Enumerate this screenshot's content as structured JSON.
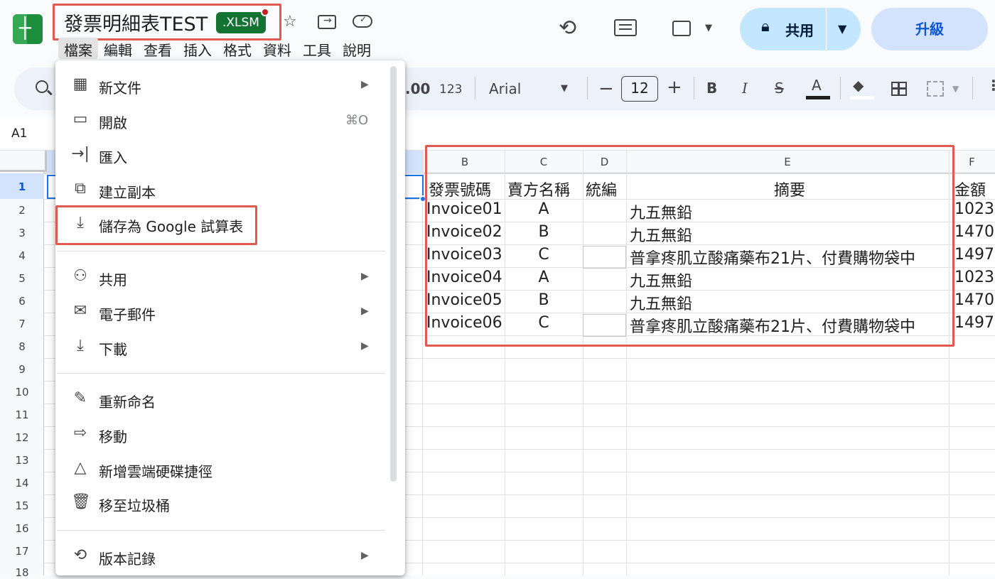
{
  "header": {
    "doc_title": "發票明細表TEST",
    "badge": ".XLSM",
    "menu": [
      "檔案",
      "編輯",
      "查看",
      "插入",
      "格式",
      "資料",
      "工具",
      "說明"
    ],
    "share_label": "共用",
    "upgrade_label": "升級"
  },
  "toolbar": {
    "decimal_label": ".00",
    "number_format_label": "123",
    "font_name": "Arial",
    "font_size": "12",
    "bold_label": "B",
    "italic_label": "I",
    "text_color_label": "A"
  },
  "namebox": "A1",
  "file_menu": {
    "items": [
      {
        "label": "新文件",
        "icon": "new-doc-icon"
      },
      {
        "label": "開啟",
        "icon": "folder-icon",
        "shortcut": "⌘O"
      },
      {
        "label": "匯入",
        "icon": "import-icon"
      },
      {
        "label": "建立副本",
        "icon": "copy-icon"
      },
      {
        "label": "儲存為 Google 試算表",
        "icon": "save-icon"
      },
      {
        "label": "共用",
        "icon": "person-add-icon"
      },
      {
        "label": "電子郵件",
        "icon": "mail-icon"
      },
      {
        "label": "下載",
        "icon": "download-icon"
      },
      {
        "label": "重新命名",
        "icon": "pencil-icon"
      },
      {
        "label": "移動",
        "icon": "move-icon"
      },
      {
        "label": "新增雲端硬碟捷徑",
        "icon": "drive-shortcut-icon"
      },
      {
        "label": "移至垃圾桶",
        "icon": "trash-icon"
      },
      {
        "label": "版本記錄",
        "icon": "history-icon"
      }
    ]
  },
  "grid": {
    "row_numbers": [
      "1",
      "2",
      "3",
      "4",
      "5",
      "6",
      "7",
      "8",
      "9",
      "10",
      "11",
      "12",
      "13",
      "14",
      "15",
      "16",
      "17",
      "18"
    ],
    "column_headers": [
      "B",
      "C",
      "D",
      "E",
      "F"
    ],
    "header_row": [
      "發票號碼",
      "賣方名稱",
      "統編",
      "摘要",
      "金額"
    ],
    "rows": [
      [
        "Invoice01",
        "A",
        "",
        "九五無鉛",
        "1023"
      ],
      [
        "Invoice02",
        "B",
        "",
        "九五無鉛",
        "1470"
      ],
      [
        "Invoice03",
        "C",
        "",
        "普拿疼肌立酸痛藥布21片、付費購物袋中",
        "1497"
      ],
      [
        "Invoice04",
        "A",
        "",
        "九五無鉛",
        "1023"
      ],
      [
        "Invoice05",
        "B",
        "",
        "九五無鉛",
        "1470"
      ],
      [
        "Invoice06",
        "C",
        "",
        "普拿疼肌立酸痛藥布21片、付費購物袋中",
        "1497"
      ]
    ]
  }
}
